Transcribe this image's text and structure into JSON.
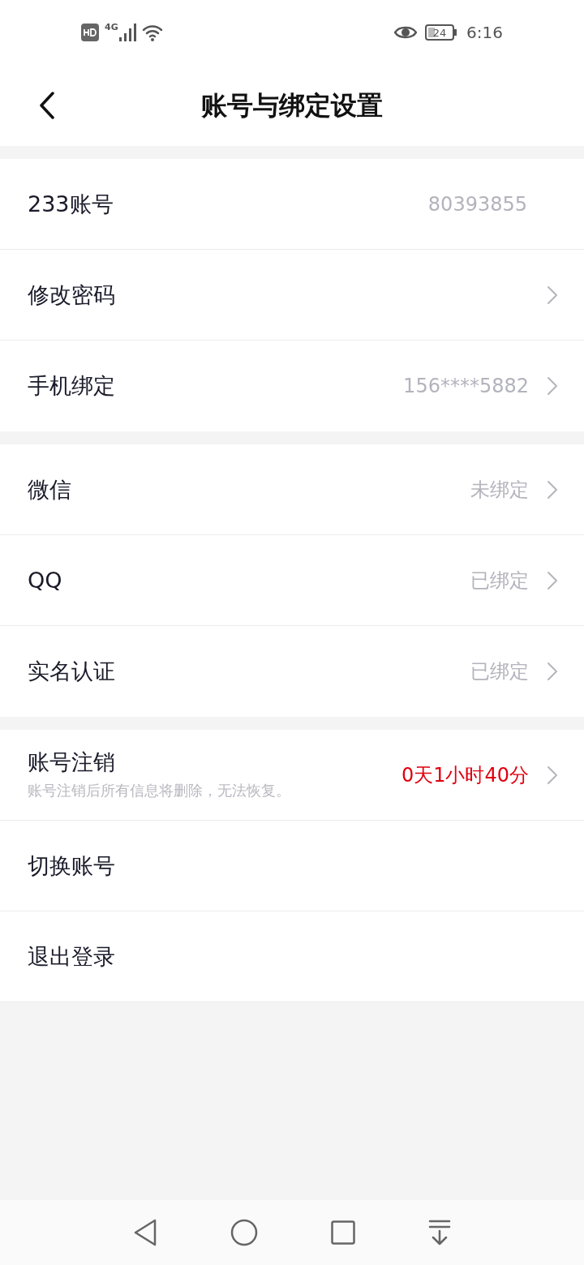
{
  "status_bar": {
    "network": "4G",
    "battery": "24",
    "time": "6:16"
  },
  "header": {
    "title": "账号与绑定设置"
  },
  "sections": [
    {
      "rows": [
        {
          "label": "233账号",
          "value": "80393855",
          "chevron": false,
          "highlight": false
        },
        {
          "label": "修改密码",
          "chevron": true
        },
        {
          "label": "手机绑定",
          "value": "156****5882",
          "chevron": true,
          "highlight": false
        }
      ]
    },
    {
      "rows": [
        {
          "label": "微信",
          "value": "未绑定",
          "chevron": true,
          "highlight": false
        },
        {
          "label": "QQ",
          "value": "已绑定",
          "chevron": true,
          "highlight": false
        },
        {
          "label": "实名认证",
          "value": "已绑定",
          "chevron": true,
          "highlight": false
        }
      ]
    },
    {
      "rows": [
        {
          "label": "账号注销",
          "subtitle": "账号注销后所有信息将删除，无法恢复。",
          "value": "0天1小时40分",
          "chevron": true,
          "highlight": true
        },
        {
          "label": "切换账号",
          "chevron": false
        },
        {
          "label": "退出登录",
          "chevron": false
        }
      ]
    }
  ]
}
